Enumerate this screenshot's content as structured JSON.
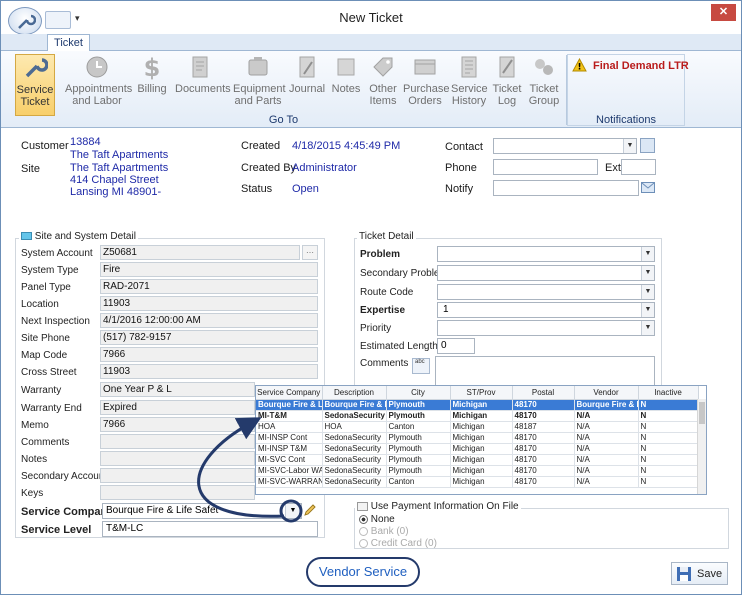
{
  "window": {
    "title": "New Ticket"
  },
  "ribbon": {
    "tab": "Ticket",
    "buttons": [
      {
        "label": "Service Ticket",
        "icon": "wrench-icon",
        "active": true
      },
      {
        "label": "Appointments and Labor",
        "icon": "clock-icon"
      },
      {
        "label": "Billing",
        "icon": "dollar-icon"
      },
      {
        "label": "Documents",
        "icon": "document-icon"
      },
      {
        "label": "Equipment and Parts",
        "icon": "equipment-icon"
      },
      {
        "label": "Journal",
        "icon": "journal-icon"
      },
      {
        "label": "Notes",
        "icon": "notes-icon"
      },
      {
        "label": "Other Items",
        "icon": "tag-icon"
      },
      {
        "label": "Purchase Orders",
        "icon": "purchase-icon"
      },
      {
        "label": "Service History",
        "icon": "history-icon"
      },
      {
        "label": "Ticket Log",
        "icon": "log-icon"
      },
      {
        "label": "Ticket Group",
        "icon": "group-icon"
      }
    ],
    "group_goto": "Go To",
    "notification": "Final Demand LTR",
    "group_notifications": "Notifications"
  },
  "header": {
    "customer_label": "Customer",
    "customer_number": "13884",
    "customer_name": "The Taft Apartments",
    "site_label": "Site",
    "site_name": "The Taft Apartments",
    "site_address": "414 Chapel Street",
    "site_city": "Lansing MI 48901-",
    "created_label": "Created",
    "created_value": "4/18/2015 4:45:49 PM",
    "created_by_label": "Created By",
    "created_by_value": "Administrator",
    "status_label": "Status",
    "status_value": "Open",
    "contact_label": "Contact",
    "phone_label": "Phone",
    "ext_label": "Ext",
    "notify_label": "Notify"
  },
  "site_detail": {
    "title": "Site and System Detail",
    "system_account_label": "System Account",
    "system_account": "Z50681",
    "system_type_label": "System Type",
    "system_type": "Fire",
    "panel_type_label": "Panel Type",
    "panel_type": "RAD-2071",
    "location_label": "Location",
    "location": "11903",
    "next_inspection_label": "Next Inspection",
    "next_inspection": "4/1/2016 12:00:00 AM",
    "site_phone_label": "Site Phone",
    "site_phone": "(517) 782-9157",
    "map_code_label": "Map Code",
    "map_code": "7966",
    "cross_street_label": "Cross Street",
    "cross_street": "11903",
    "warranty_label": "Warranty",
    "warranty": "One Year P & L",
    "warranty_end_label": "Warranty End",
    "warranty_end": "Expired",
    "memo_label": "Memo",
    "memo": "7966",
    "comments_label": "Comments",
    "notes_label": "Notes",
    "secondary_account_label": "Secondary Account",
    "keys_label": "Keys",
    "service_company_label": "Service Company",
    "service_company": "Bourque Fire & Life Safet",
    "service_level_label": "Service Level",
    "service_level": "T&M-LC"
  },
  "ticket_detail": {
    "title": "Ticket Detail",
    "problem_label": "Problem",
    "secondary_problem_label": "Secondary Problem",
    "route_code_label": "Route Code",
    "expertise_label": "Expertise",
    "expertise": "1",
    "priority_label": "Priority",
    "estimated_length_label": "Estimated Length",
    "estimated_length": "0",
    "comments_label": "Comments"
  },
  "grid": {
    "columns": [
      "Service Company",
      "Description",
      "City",
      "ST/Prov",
      "Postal",
      "Vendor",
      "Inactive"
    ],
    "rows": [
      [
        "Bourque Fire & Lif",
        "Bourque Fire & Li",
        "Plymouth",
        "Michigan",
        "48170",
        "Bourque Fire & Li",
        "N"
      ],
      [
        "MI-T&M",
        "SedonaSecurity",
        "Plymouth",
        "Michigan",
        "48170",
        "N/A",
        "N"
      ],
      [
        "HOA",
        "HOA",
        "Canton",
        "Michigan",
        "48187",
        "N/A",
        "N"
      ],
      [
        "MI-INSP Cont",
        "SedonaSecurity",
        "Plymouth",
        "Michigan",
        "48170",
        "N/A",
        "N"
      ],
      [
        "MI-INSP T&M",
        "SedonaSecurity",
        "Plymouth",
        "Michigan",
        "48170",
        "N/A",
        "N"
      ],
      [
        "MI-SVC Cont",
        "SedonaSecurity",
        "Plymouth",
        "Michigan",
        "48170",
        "N/A",
        "N"
      ],
      [
        "MI-SVC-Labor WA",
        "SedonaSecurity",
        "Plymouth",
        "Michigan",
        "48170",
        "N/A",
        "N"
      ],
      [
        "MI-SVC-WARRAN",
        "SedonaSecurity",
        "Canton",
        "Michigan",
        "48170",
        "N/A",
        "N"
      ]
    ]
  },
  "payment": {
    "title": "Use Payment Information On File",
    "options": [
      "None",
      "Bank (0)",
      "Credit Card (0)"
    ]
  },
  "callout": "Vendor Service",
  "save_label": "Save"
}
